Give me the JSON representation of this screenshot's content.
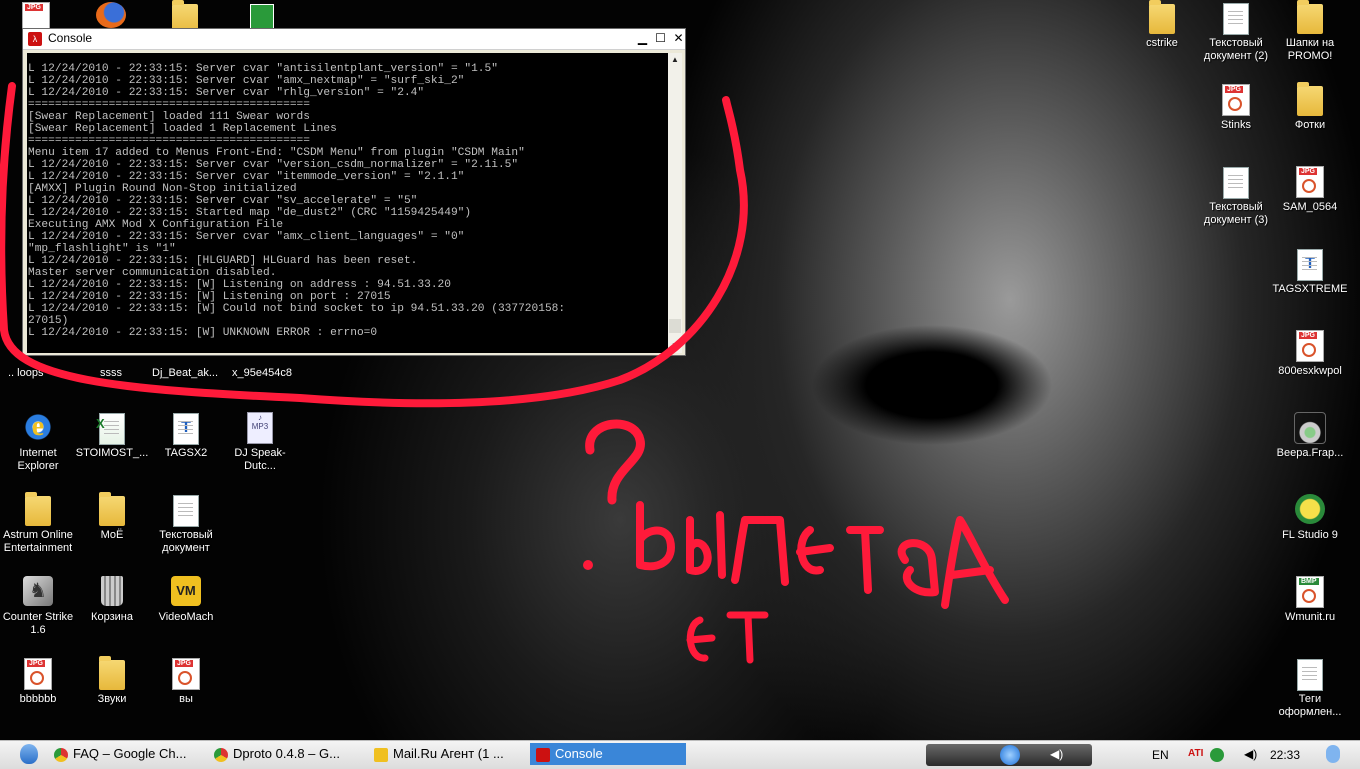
{
  "desktop": {
    "icons_left": [
      {
        "label": "Internet Explorer",
        "kind": "ie"
      },
      {
        "label": "STOIMOST_...",
        "kind": "xls"
      },
      {
        "label": "TAGSX2",
        "kind": "tags"
      },
      {
        "label": "DJ Speak-Dutc...",
        "kind": "mp3"
      },
      {
        "label": "Astrum Online Entertainment",
        "kind": "folder"
      },
      {
        "label": "МоЁ",
        "kind": "folder"
      },
      {
        "label": "Текстовый документ",
        "kind": "doc"
      },
      {
        "label": "Counter Strike 1.6",
        "kind": "cs"
      },
      {
        "label": "Корзина",
        "kind": "trash"
      },
      {
        "label": "VideoMach",
        "kind": "vm"
      },
      {
        "label": "bbbbbb",
        "kind": "jpg"
      },
      {
        "label": "Звуки",
        "kind": "folder"
      },
      {
        "label": "вы",
        "kind": "jpg"
      }
    ],
    "partial_labels": [
      ".. loops",
      "ssss",
      "Dj_Beat_ak...",
      "x_95e454c8"
    ],
    "icons_right": [
      {
        "label": "cstrike",
        "kind": "folder"
      },
      {
        "label": "Текстовый документ (2)",
        "kind": "doc"
      },
      {
        "label": "Шапки на PROMO!",
        "kind": "folder"
      },
      {
        "label": "Stinks",
        "kind": "jpg"
      },
      {
        "label": "Фотки",
        "kind": "folder"
      },
      {
        "label": "Текстовый документ (3)",
        "kind": "doc"
      },
      {
        "label": "SAM_0564",
        "kind": "jpg"
      },
      {
        "label": "TAGSXTREME",
        "kind": "tags"
      },
      {
        "label": "800esxkwpol",
        "kind": "jpg"
      },
      {
        "label": "Веера.Frap...",
        "kind": "setup"
      },
      {
        "label": "FL Studio 9",
        "kind": "fl"
      },
      {
        "label": "Wmunit.ru",
        "kind": "bmp"
      },
      {
        "label": "Теги оформлен...",
        "kind": "doc"
      }
    ],
    "annotation_text": "?вылетает"
  },
  "console": {
    "title": "Console",
    "lines": [
      "L 12/24/2010 - 22:33:15: Server cvar \"antisilentplant_version\" = \"1.5\"",
      "L 12/24/2010 - 22:33:15: Server cvar \"amx_nextmap\" = \"surf_ski_2\"",
      "L 12/24/2010 - 22:33:15: Server cvar \"rhlg_version\" = \"2.4\"",
      "==========================================",
      "[Swear Replacement] loaded 111 Swear words",
      "[Swear Replacement] loaded 1 Replacement Lines",
      "==========================================",
      "Menu item 17 added to Menus Front-End: \"CSDM Menu\" from plugin \"CSDM Main\"",
      "L 12/24/2010 - 22:33:15: Server cvar \"version_csdm_normalizer\" = \"2.1i.5\"",
      "L 12/24/2010 - 22:33:15: Server cvar \"itemmode_version\" = \"2.1.1\"",
      "[AMXX] Plugin Round Non-Stop initialized",
      "L 12/24/2010 - 22:33:15: Server cvar \"sv_accelerate\" = \"5\"",
      "L 12/24/2010 - 22:33:15: Started map \"de_dust2\" (CRC \"1159425449\")",
      "Executing AMX Mod X Configuration File",
      "L 12/24/2010 - 22:33:15: Server cvar \"amx_client_languages\" = \"0\"",
      "\"mp_flashlight\" is \"1\"",
      "L 12/24/2010 - 22:33:15: [HLGUARD] HLGuard has been reset.",
      "Master server communication disabled.",
      "L 12/24/2010 - 22:33:15: [W] Listening on address : 94.51.33.20",
      "L 12/24/2010 - 22:33:15: [W] Listening on port : 27015",
      "L 12/24/2010 - 22:33:15: [W] Could not bind socket to ip 94.51.33.20 (337720158:",
      "27015)",
      "L 12/24/2010 - 22:33:15: [W] UNKNOWN ERROR : errno=0"
    ]
  },
  "taskbar": {
    "buttons": [
      {
        "label": "FAQ – Google Ch...",
        "color": "#e8a33a"
      },
      {
        "label": "Dproto 0.4.8 – G...",
        "color": "#e8a33a"
      },
      {
        "label": "Mail.Ru Агент (1 ...",
        "color": "#f0c020"
      },
      {
        "label": "Console",
        "color": "#cc1111"
      }
    ],
    "lang": "EN",
    "clock": "22:33"
  },
  "colors": {
    "annotation": "#ff1a3a",
    "taskbar_active": "#3a86d8"
  }
}
